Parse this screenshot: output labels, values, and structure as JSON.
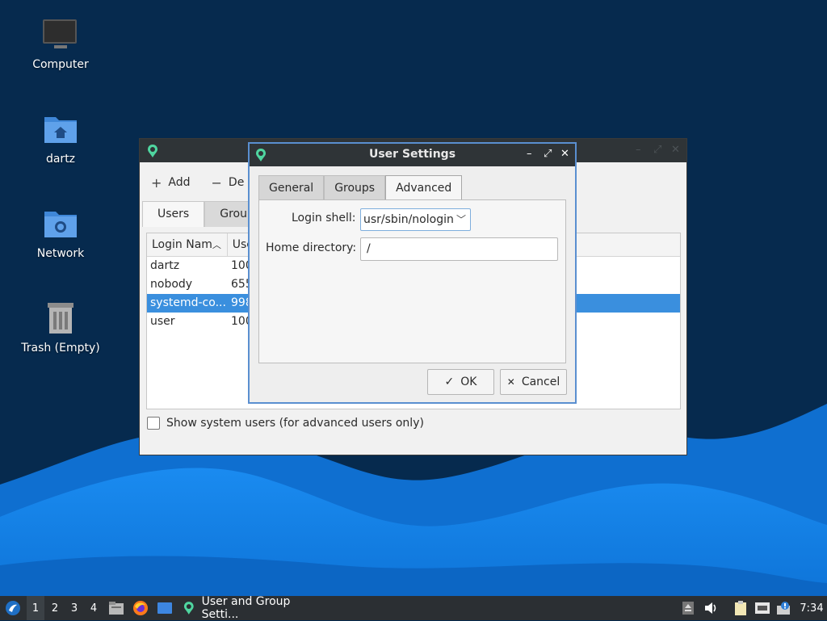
{
  "desktop": {
    "icons": [
      {
        "label": "Computer",
        "icon": "computer-icon"
      },
      {
        "label": "dartz",
        "icon": "home-folder-icon"
      },
      {
        "label": "Network",
        "icon": "network-folder-icon"
      },
      {
        "label": "Trash (Empty)",
        "icon": "trash-icon"
      }
    ]
  },
  "parent_window": {
    "title_icon": "user-settings-app-icon",
    "toolbar": {
      "add_label": "Add",
      "delete_label": "De"
    },
    "tabs": [
      {
        "label": "Users"
      },
      {
        "label": "Group"
      }
    ],
    "columns": [
      {
        "label": "Login Nam"
      },
      {
        "label": "Use"
      }
    ],
    "rows": [
      {
        "login": "dartz",
        "uid": "100"
      },
      {
        "login": "nobody",
        "uid": "655"
      },
      {
        "login": "systemd-co...",
        "uid": "998",
        "selected": true
      },
      {
        "login": "user",
        "uid": "100"
      }
    ],
    "show_system_users_label": "Show system users (for advanced users only)"
  },
  "dialog": {
    "title": "User Settings",
    "tabs": [
      {
        "label": "General"
      },
      {
        "label": "Groups"
      },
      {
        "label": "Advanced",
        "active": true
      }
    ],
    "login_shell": {
      "label": "Login shell:",
      "value": "usr/sbin/nologin"
    },
    "home_directory": {
      "label": "Home directory:",
      "value": "/"
    },
    "ok_label": "OK",
    "cancel_label": "Cancel"
  },
  "taskbar": {
    "workspaces": [
      "1",
      "2",
      "3",
      "4"
    ],
    "active_window_label": "User and Group Setti...",
    "clock": "7:34"
  },
  "colors": {
    "desktop_bg": "#062a4e",
    "selection": "#3a8fde",
    "dialog_border": "#5a8fd0",
    "titlebar": "#2f3437",
    "taskbar": "#2b2f33"
  }
}
